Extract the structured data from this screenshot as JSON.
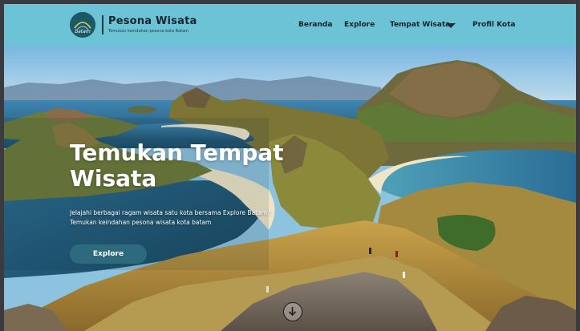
{
  "brand": {
    "logo_text": "batam",
    "title": "Pesona Wisata",
    "tagline": "Temukan keindahan pesona kota Batam"
  },
  "nav": {
    "items": [
      "Beranda",
      "Explore",
      "Tempat Wisata",
      "Profil Kota"
    ],
    "dropdown_icon": "chevron-down-icon"
  },
  "hero": {
    "title": "Temukan Tempat Wisata",
    "description_line1": "Jelajahi berbagai ragam wisata satu kota bersama Explore Batam !",
    "description_line2": "Temukan keindahan pesona wisata kota batam",
    "button_label": "Explore",
    "scroll_icon": "arrow-down-circle-icon"
  },
  "colors": {
    "header_bg": "#6cc3d6",
    "button_bg": "#2d6a7e",
    "text_dark": "#14262e",
    "page_border": "#3b3b3f"
  }
}
